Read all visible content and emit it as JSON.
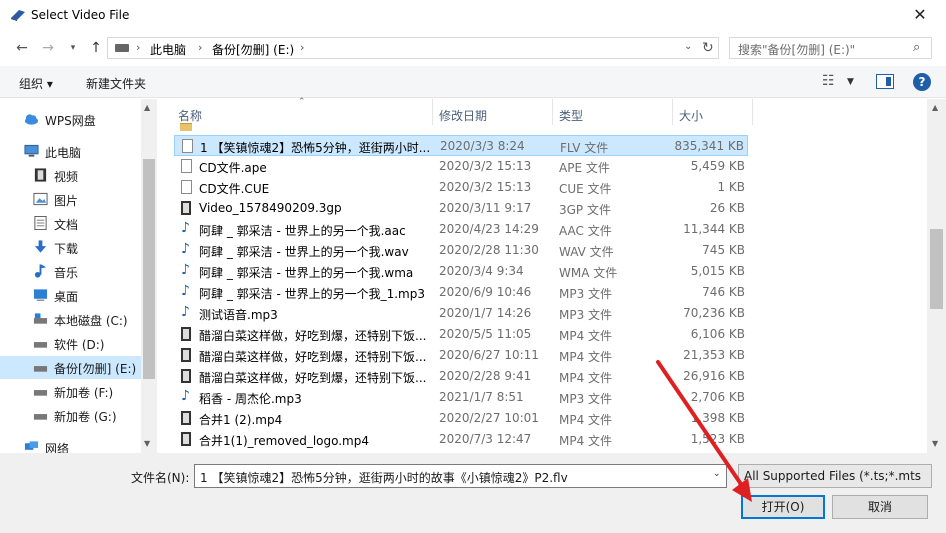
{
  "window": {
    "title": "Select Video File"
  },
  "address": {
    "crumbs": [
      "此电脑",
      "备份[勿删] (E:)"
    ],
    "separator": "›",
    "search_placeholder": "搜索\"备份[勿删] (E:)\""
  },
  "toolbar": {
    "organize": "组织 ▾",
    "new_folder": "新建文件夹"
  },
  "nav": {
    "items": [
      {
        "label": "WPS网盘",
        "icon": "cloud-icon"
      },
      {
        "label": "此电脑",
        "icon": "computer-icon"
      },
      {
        "label": "视频",
        "icon": "video-folder-icon"
      },
      {
        "label": "图片",
        "icon": "pictures-folder-icon"
      },
      {
        "label": "文档",
        "icon": "documents-folder-icon"
      },
      {
        "label": "下载",
        "icon": "download-icon"
      },
      {
        "label": "音乐",
        "icon": "music-icon"
      },
      {
        "label": "桌面",
        "icon": "desktop-icon"
      },
      {
        "label": "本地磁盘 (C:)",
        "icon": "drive-icon"
      },
      {
        "label": "软件 (D:)",
        "icon": "drive-icon"
      },
      {
        "label": "备份[勿删] (E:)",
        "icon": "drive-icon"
      },
      {
        "label": "新加卷 (F:)",
        "icon": "drive-icon"
      },
      {
        "label": "新加卷 (G:)",
        "icon": "drive-icon"
      },
      {
        "label": "网络",
        "icon": "network-icon"
      }
    ]
  },
  "columns": {
    "name": "名称",
    "date": "修改日期",
    "type": "类型",
    "size": "大小"
  },
  "files": [
    {
      "name": "1 【笑镇惊魂2】恐怖5分钟，逛街两小时...",
      "date": "2020/3/3 8:24",
      "type": "FLV 文件",
      "size": "835,341 KB",
      "kind": "doc"
    },
    {
      "name": "CD文件.ape",
      "date": "2020/3/2 15:13",
      "type": "APE 文件",
      "size": "5,459 KB",
      "kind": "doc"
    },
    {
      "name": "CD文件.CUE",
      "date": "2020/3/2 15:13",
      "type": "CUE 文件",
      "size": "1 KB",
      "kind": "doc"
    },
    {
      "name": "Video_1578490209.3gp",
      "date": "2020/3/11 9:17",
      "type": "3GP 文件",
      "size": "26 KB",
      "kind": "video"
    },
    {
      "name": "阿肆 _ 郭采洁 - 世界上的另一个我.aac",
      "date": "2020/4/23 14:29",
      "type": "AAC 文件",
      "size": "11,344 KB",
      "kind": "audio"
    },
    {
      "name": "阿肆 _ 郭采洁 - 世界上的另一个我.wav",
      "date": "2020/2/28 11:30",
      "type": "WAV 文件",
      "size": "745 KB",
      "kind": "audio"
    },
    {
      "name": "阿肆 _ 郭采洁 - 世界上的另一个我.wma",
      "date": "2020/3/4 9:34",
      "type": "WMA 文件",
      "size": "5,015 KB",
      "kind": "audio"
    },
    {
      "name": "阿肆 _ 郭采洁 - 世界上的另一个我_1.mp3",
      "date": "2020/6/9 10:46",
      "type": "MP3 文件",
      "size": "746 KB",
      "kind": "audio"
    },
    {
      "name": "测试语音.mp3",
      "date": "2020/1/7 14:26",
      "type": "MP3 文件",
      "size": "70,236 KB",
      "kind": "audio"
    },
    {
      "name": "醋溜白菜这样做，好吃到爆，还特别下饭...",
      "date": "2020/5/5 11:05",
      "type": "MP4 文件",
      "size": "6,106 KB",
      "kind": "video"
    },
    {
      "name": "醋溜白菜这样做，好吃到爆，还特别下饭...",
      "date": "2020/6/27 10:11",
      "type": "MP4 文件",
      "size": "21,353 KB",
      "kind": "video"
    },
    {
      "name": "醋溜白菜这样做，好吃到爆，还特别下饭...",
      "date": "2020/2/28 9:41",
      "type": "MP4 文件",
      "size": "26,916 KB",
      "kind": "video"
    },
    {
      "name": "稻香 - 周杰伦.mp3",
      "date": "2021/1/7 8:51",
      "type": "MP3 文件",
      "size": "2,706 KB",
      "kind": "audio"
    },
    {
      "name": "合并1 (2).mp4",
      "date": "2020/2/27 10:01",
      "type": "MP4 文件",
      "size": "1,398 KB",
      "kind": "video"
    },
    {
      "name": "合并1(1)_removed_logo.mp4",
      "date": "2020/7/3 12:47",
      "type": "MP4 文件",
      "size": "1,523 KB",
      "kind": "video"
    }
  ],
  "bottom": {
    "filename_label": "文件名(N):",
    "filename_value": "1 【笑镇惊魂2】恐怖5分钟，逛街两小时的故事《小镇惊魂2》P2.flv",
    "filter_value": "All Supported Files (*.ts;*.mts",
    "open_label": "打开(O)",
    "cancel_label": "取消"
  },
  "colors": {
    "selection": "#cce8ff",
    "accent": "#0078d7",
    "arrow": "#e02020"
  }
}
